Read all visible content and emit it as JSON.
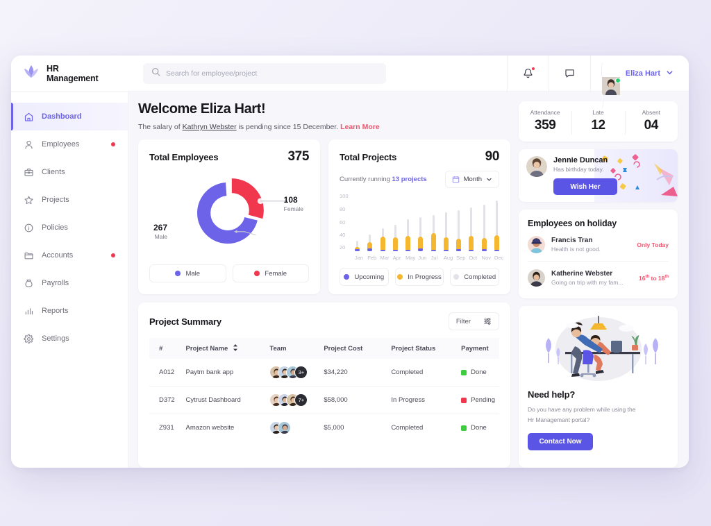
{
  "brand": {
    "line1": "HR",
    "line2": "Management",
    "logo_icon": "lotus-logo-icon"
  },
  "search": {
    "placeholder": "Search for employee/project",
    "value": "",
    "icon": "search-icon"
  },
  "topbar": {
    "notification_icon": "bell-icon",
    "messages_icon": "chat-bubble-icon",
    "user_name": "Eliza Hart",
    "chevron_icon": "chevron-down-icon"
  },
  "sidebar": {
    "items": [
      {
        "label": "Dashboard",
        "icon": "home-icon",
        "active": true,
        "badge": false
      },
      {
        "label": "Employees",
        "icon": "person-icon",
        "active": false,
        "badge": true
      },
      {
        "label": "Clients",
        "icon": "briefcase-icon",
        "active": false,
        "badge": false
      },
      {
        "label": "Projects",
        "icon": "star-icon",
        "active": false,
        "badge": false
      },
      {
        "label": "Policies",
        "icon": "info-circle-icon",
        "active": false,
        "badge": false
      },
      {
        "label": "Accounts",
        "icon": "folder-icon",
        "active": false,
        "badge": true
      },
      {
        "label": "Payrolls",
        "icon": "money-bag-icon",
        "active": false,
        "badge": false
      },
      {
        "label": "Reports",
        "icon": "bar-chart-icon",
        "active": false,
        "badge": false
      },
      {
        "label": "Settings",
        "icon": "gear-icon",
        "active": false,
        "badge": false
      }
    ]
  },
  "welcome": {
    "heading": "Welcome Eliza Hart!",
    "text_before": "The salary of ",
    "employee": "Kathryn Webster",
    "text_after": " is pending since 15 December. ",
    "learn_more": "Learn More"
  },
  "employees_card": {
    "title": "Total Employees",
    "total": "375",
    "male_value": "267",
    "male_caption": "Male",
    "female_value": "108",
    "female_caption": "Female",
    "legend": [
      {
        "label": "Male",
        "color": "#6c63e8"
      },
      {
        "label": "Female",
        "color": "#f0374e"
      }
    ]
  },
  "projects_card": {
    "title": "Total Projects",
    "total": "90",
    "running_prefix": "Currently running ",
    "running_count": "13 projects",
    "period_label": "Month",
    "calendar_icon": "calendar-icon",
    "chevron_icon": "chevron-down-icon",
    "legend": [
      {
        "label": "Upcoming",
        "color": "#6c63e8"
      },
      {
        "label": "In Progress",
        "color": "#f5b730"
      },
      {
        "label": "Completed",
        "color": "#e2e2e8"
      }
    ]
  },
  "chart_data": [
    {
      "type": "pie",
      "title": "Total Employees",
      "labels": [
        "Male",
        "Female"
      ],
      "values": [
        267,
        108
      ],
      "colors": [
        "#6c63e8",
        "#f0374e"
      ],
      "total": 375,
      "donut": true,
      "legend_position": "bottom"
    },
    {
      "type": "bar",
      "title": "Total Projects",
      "categories": [
        "Jan",
        "Feb",
        "Mar",
        "Apr",
        "May",
        "Jun",
        "Jul",
        "Aug",
        "Sep",
        "Oct",
        "Nov",
        "Dec"
      ],
      "ylabel": "",
      "xlabel": "",
      "ylim": [
        20,
        100
      ],
      "yticks": [
        20,
        40,
        60,
        80,
        100
      ],
      "grid": false,
      "legend_position": "bottom",
      "stacked": true,
      "series": [
        {
          "name": "Upcoming",
          "color": "#6c63e8",
          "values": [
            23,
            24,
            22,
            22,
            22,
            24,
            22,
            22,
            23,
            22,
            23,
            22
          ]
        },
        {
          "name": "In Progress",
          "color": "#f5b730",
          "values": [
            26,
            32,
            40,
            39,
            41,
            40,
            45,
            39,
            37,
            41,
            38,
            42
          ]
        },
        {
          "name": "Completed",
          "color": "#e2e2e8",
          "values": [
            34,
            43,
            51,
            56,
            64,
            67,
            70,
            73,
            76,
            80,
            84,
            90
          ]
        }
      ]
    }
  ],
  "summary": {
    "title": "Project Summary",
    "filter_label": "Filter",
    "filter_icon": "sliders-icon",
    "sort_icon": "sort-arrows-icon",
    "columns": [
      "#",
      "Project Name",
      "Team",
      "Project Cost",
      "Project Status",
      "Payment"
    ],
    "rows": [
      {
        "id": "A012",
        "name": "Paytm bank app",
        "team_extra": "3+",
        "team_avatars": 3,
        "cost": "$34,220",
        "status": "Completed",
        "payment": "Done",
        "payment_color": "#3ecb3e"
      },
      {
        "id": "D372",
        "name": "Cytrust Dashboard",
        "team_extra": "7+",
        "team_avatars": 3,
        "cost": "$58,000",
        "status": "In Progress",
        "payment": "Pending",
        "payment_color": "#f0374e"
      },
      {
        "id": "Z931",
        "name": "Amazon website",
        "team_extra": "",
        "team_avatars": 2,
        "cost": "$5,000",
        "status": "Completed",
        "payment": "Done",
        "payment_color": "#3ecb3e"
      }
    ]
  },
  "stats": [
    {
      "caption": "Attendance",
      "value": "359"
    },
    {
      "caption": "Late",
      "value": "12"
    },
    {
      "caption": "Absent",
      "value": "04"
    }
  ],
  "birthday": {
    "name": "Jennie Duncan",
    "note": "Has birthday today.",
    "button": "Wish Her"
  },
  "holiday": {
    "title": "Employees on holiday",
    "rows": [
      {
        "name": "Francis Tran",
        "note": "Health is not good.",
        "when": "Only Today",
        "when_sup1": "",
        "when_sup2": ""
      },
      {
        "name": "Katherine Webster",
        "note": "Going on trip with my fam...",
        "when_prefix": "16",
        "when_sup1": "th",
        "when_mid": " to 18",
        "when_sup2": "th"
      }
    ]
  },
  "help": {
    "title": "Need help?",
    "line1": "Do you have any problem while using the",
    "line2": "Hr Managemant portal?",
    "button": "Contact Now",
    "illustration_icon": "office-desk-illustration"
  },
  "colors": {
    "accent": "#6c63e8",
    "accent_button": "#5b55e6",
    "danger": "#f0374e",
    "pink": "#f0556e",
    "amber": "#f5b730",
    "green": "#3ecb3e",
    "grey_bar": "#e2e2e8",
    "page_bg": "#f7f7fb"
  }
}
